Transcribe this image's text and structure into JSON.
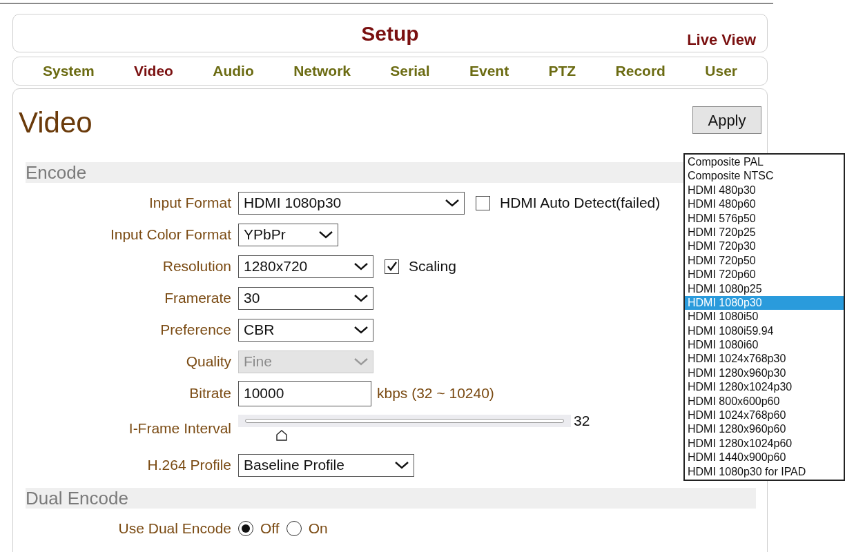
{
  "header": {
    "title": "Setup",
    "live_view": "Live View"
  },
  "nav": [
    {
      "label": "System",
      "selected": false
    },
    {
      "label": "Video",
      "selected": true
    },
    {
      "label": "Audio",
      "selected": false
    },
    {
      "label": "Network",
      "selected": false
    },
    {
      "label": "Serial",
      "selected": false
    },
    {
      "label": "Event",
      "selected": false
    },
    {
      "label": "PTZ",
      "selected": false
    },
    {
      "label": "Record",
      "selected": false
    },
    {
      "label": "User",
      "selected": false
    }
  ],
  "page_title": "Video",
  "apply_button": "Apply",
  "sections": [
    {
      "title": "Encode",
      "rows": [
        {
          "kind": "select",
          "label": "Input Format",
          "value": "HDMI 1080p30",
          "disabled": false,
          "checkbox": {
            "label": "HDMI Auto Detect(failed)",
            "checked": false
          }
        },
        {
          "kind": "select",
          "label": "Input Color Format",
          "value": "YPbPr",
          "disabled": false
        },
        {
          "kind": "select",
          "label": "Resolution",
          "value": "1280x720",
          "disabled": false,
          "checkbox": {
            "label": "Scaling",
            "checked": true
          }
        },
        {
          "kind": "select",
          "label": "Framerate",
          "value": "30",
          "disabled": false
        },
        {
          "kind": "select",
          "label": "Preference",
          "value": "CBR",
          "disabled": false
        },
        {
          "kind": "select",
          "label": "Quality",
          "value": "Fine",
          "disabled": true
        },
        {
          "kind": "input",
          "label": "Bitrate",
          "value": "10000",
          "suffix": "kbps (32 ~ 10240)"
        },
        {
          "kind": "slider",
          "label": "I-Frame Interval",
          "level": 0.13,
          "reading": "32"
        },
        {
          "kind": "select",
          "label": "H.264 Profile",
          "value": "Baseline Profile",
          "disabled": false
        }
      ]
    },
    {
      "title": "Dual Encode",
      "rows": [
        {
          "kind": "radio",
          "label": "Use Dual Encode",
          "options": [
            {
              "label": "Off",
              "selected": true
            },
            {
              "label": "On",
              "selected": false
            }
          ]
        }
      ]
    }
  ],
  "dropdown": {
    "options": [
      {
        "label": "Composite PAL",
        "selected": false
      },
      {
        "label": "Composite NTSC",
        "selected": false
      },
      {
        "label": "HDMI 480p30",
        "selected": false
      },
      {
        "label": "HDMI 480p60",
        "selected": false
      },
      {
        "label": "HDMI 576p50",
        "selected": false
      },
      {
        "label": "HDMI 720p25",
        "selected": false
      },
      {
        "label": "HDMI 720p30",
        "selected": false
      },
      {
        "label": "HDMI 720p50",
        "selected": false
      },
      {
        "label": "HDMI 720p60",
        "selected": false
      },
      {
        "label": "HDMI 1080p25",
        "selected": false
      },
      {
        "label": "HDMI 1080p30",
        "selected": true
      },
      {
        "label": "HDMI 1080i50",
        "selected": false
      },
      {
        "label": "HDMI 1080i59.94",
        "selected": false
      },
      {
        "label": "HDMI 1080i60",
        "selected": false
      },
      {
        "label": "HDMI 1024x768p30",
        "selected": false
      },
      {
        "label": "HDMI 1280x960p30",
        "selected": false
      },
      {
        "label": "HDMI 1280x1024p30",
        "selected": false
      },
      {
        "label": "HDMI 800x600p60",
        "selected": false
      },
      {
        "label": "HDMI 1024x768p60",
        "selected": false
      },
      {
        "label": "HDMI 1280x960p60",
        "selected": false
      },
      {
        "label": "HDMI 1280x1024p60",
        "selected": false
      },
      {
        "label": "HDMI 1440x900p60",
        "selected": false
      },
      {
        "label": "HDMI 1080p30 for IPAD",
        "selected": false
      }
    ]
  }
}
